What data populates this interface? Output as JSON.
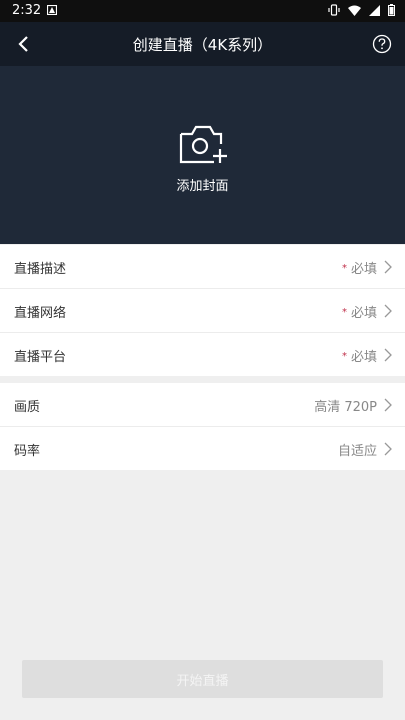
{
  "status_bar": {
    "time": "2:32"
  },
  "app_bar": {
    "title": "创建直播（4K系列）"
  },
  "cover": {
    "label": "添加封面"
  },
  "required_fields": [
    {
      "label": "直播描述",
      "value": "必填"
    },
    {
      "label": "直播网络",
      "value": "必填"
    },
    {
      "label": "直播平台",
      "value": "必填"
    }
  ],
  "settings": [
    {
      "label": "画质",
      "value": "高清 720P"
    },
    {
      "label": "码率",
      "value": "自适应"
    }
  ],
  "start_button": {
    "label": "开始直播"
  },
  "colors": {
    "header_bg": "#151c27",
    "cover_bg": "#1f2938",
    "required_star": "#c0304a"
  }
}
